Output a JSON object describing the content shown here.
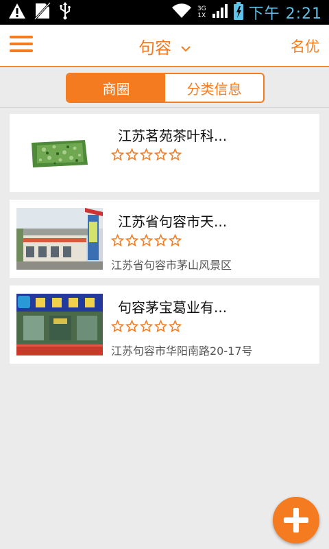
{
  "status_bar": {
    "time": "下午 2:21",
    "network_top": "3G",
    "network_bottom": "1X",
    "icons": [
      "warning-icon",
      "no-sim-icon",
      "usb-icon",
      "wifi-icon",
      "signal-icon",
      "battery-icon"
    ]
  },
  "header": {
    "city": "句容",
    "right_label": "名优"
  },
  "tabs": [
    {
      "label": "商圈",
      "active": true
    },
    {
      "label": "分类信息",
      "active": false
    }
  ],
  "listings": [
    {
      "title": "江苏茗苑茶叶科...",
      "rating": 0,
      "max_rating": 5,
      "address": "",
      "image": "tea-leaves-image"
    },
    {
      "title": "江苏省句容市天...",
      "rating": 0,
      "max_rating": 5,
      "address": "江苏省句容市茅山风景区",
      "image": "building-storefront-image"
    },
    {
      "title": "句容茅宝葛业有...",
      "rating": 0,
      "max_rating": 5,
      "address": "江苏句容市华阳南路20-17号",
      "image": "shop-storefront-image"
    }
  ],
  "colors": {
    "accent": "#f47b20",
    "background": "#ebebeb",
    "status_time": "#5fc2e8"
  }
}
